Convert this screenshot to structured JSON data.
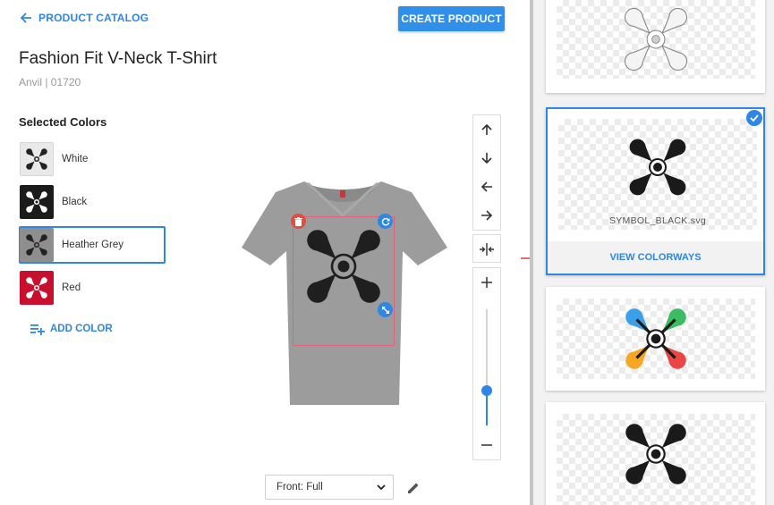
{
  "header": {
    "back_label": "PRODUCT CATALOG",
    "create_label": "CREATE PRODUCT"
  },
  "product": {
    "title": "Fashion Fit V-Neck T-Shirt",
    "subtitle": "Anvil | 01720"
  },
  "colors": {
    "section_title": "Selected Colors",
    "items": [
      {
        "label": "White",
        "swatch": "#e9e9e9",
        "icon_color": "#222222",
        "selected": false
      },
      {
        "label": "Black",
        "swatch": "#1b1b1b",
        "icon_color": "#ffffff",
        "selected": false
      },
      {
        "label": "Heather Grey",
        "swatch": "#8e8e8e",
        "icon_color": "#222222",
        "selected": true
      },
      {
        "label": "Red",
        "swatch": "#c8102e",
        "icon_color": "#ffffff",
        "selected": false
      }
    ],
    "add_label": "ADD COLOR"
  },
  "canvas": {
    "shirt_color": "#9b9b9b",
    "view_select": "Front: Full"
  },
  "toolbar": {
    "icons": [
      "arrow-up-icon",
      "arrow-down-icon",
      "arrow-left-icon",
      "arrow-right-icon",
      "center-horizontal-icon",
      "zoom-in-icon",
      "zoom-out-icon"
    ],
    "zoom_level": 0.3
  },
  "designs": {
    "cards": [
      {
        "file": "",
        "style": "outline",
        "selected": false,
        "action": ""
      },
      {
        "file": "SYMBOL_BLACK.svg",
        "style": "black",
        "selected": true,
        "action": "VIEW COLORWAYS"
      },
      {
        "file": "",
        "style": "multicolor",
        "selected": false,
        "action": ""
      },
      {
        "file": "",
        "style": "black",
        "selected": false,
        "action": ""
      }
    ]
  },
  "palette": {
    "accent": "#2f86e6",
    "delete": "#e84a3d",
    "guide": "#e0637a",
    "multicolor": [
      "#3aa0ea",
      "#3dbb63",
      "#f5a623",
      "#ec4545"
    ]
  }
}
